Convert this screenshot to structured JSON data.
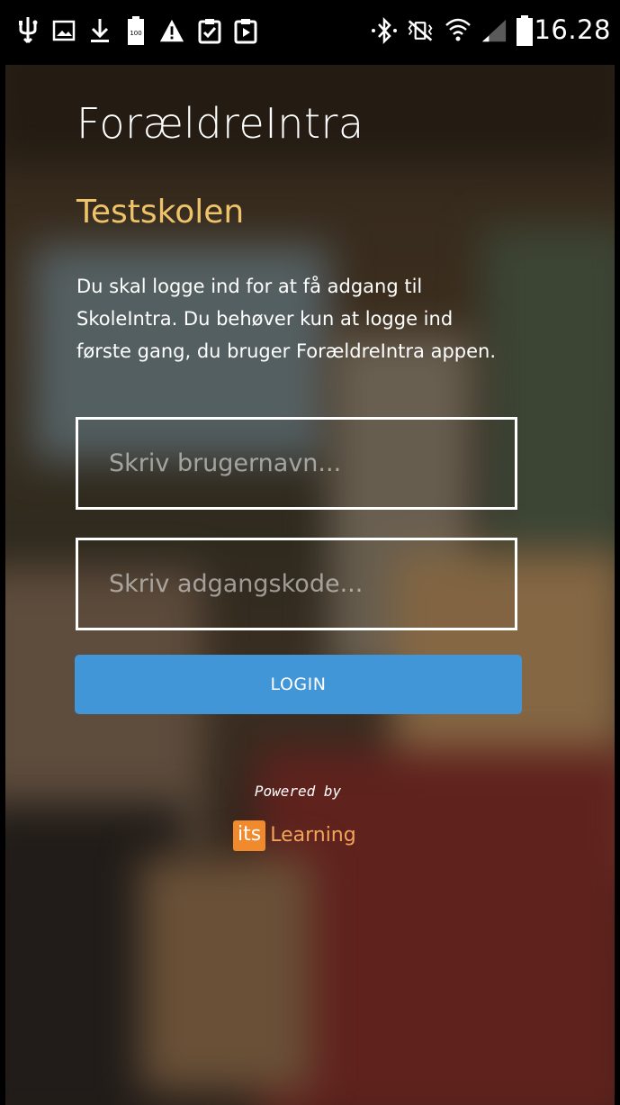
{
  "status_bar": {
    "time": "16.28",
    "icons": [
      "usb-icon",
      "image-icon",
      "download-icon",
      "battery-100-icon",
      "warning-icon",
      "clipboard-check-icon",
      "clipboard-play-icon",
      "bluetooth-icon",
      "vibrate-mute-icon",
      "wifi-icon",
      "signal-icon",
      "battery-icon"
    ],
    "battery_label": "100"
  },
  "app": {
    "title": "ForældreIntra",
    "school": "Testskolen",
    "intro": "Du skal logge ind for at få adgang til SkoleIntra. Du behøver kun at logge ind første gang, du bruger ForældreIntra appen."
  },
  "form": {
    "username_placeholder": "Skriv brugernavn...",
    "password_placeholder": "Skriv adgangskode...",
    "login_label": "LOGIN"
  },
  "footer": {
    "powered_by": "Powered by",
    "brand_its": "its",
    "brand_learning": "Learning"
  },
  "colors": {
    "accent_button": "#4196d8",
    "school_name": "#eec36a",
    "brand_orange": "#f08a2c"
  }
}
